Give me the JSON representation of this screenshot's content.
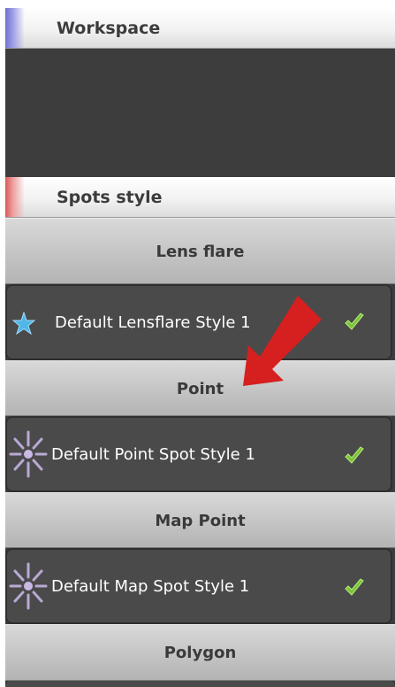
{
  "workspace": {
    "label": "Workspace"
  },
  "spots_style": {
    "label": "Spots style"
  },
  "categories": [
    {
      "label": "Lens flare",
      "item": {
        "name": "Default Lensflare Style 1",
        "icon": "star-icon",
        "checked": true
      }
    },
    {
      "label": "Point",
      "item": {
        "name": "Default Point Spot Style 1",
        "icon": "burst-icon",
        "checked": true
      }
    },
    {
      "label": "Map Point",
      "item": {
        "name": "Default Map Spot Style 1",
        "icon": "burst-icon",
        "checked": true
      }
    },
    {
      "label": "Polygon"
    }
  ],
  "colors": {
    "workspace_accent": "#8a8ad8",
    "spots_accent": "#e07a7a",
    "check": "#7cc13a",
    "arrow": "#d61f1f",
    "star": "#4fb6e6"
  }
}
